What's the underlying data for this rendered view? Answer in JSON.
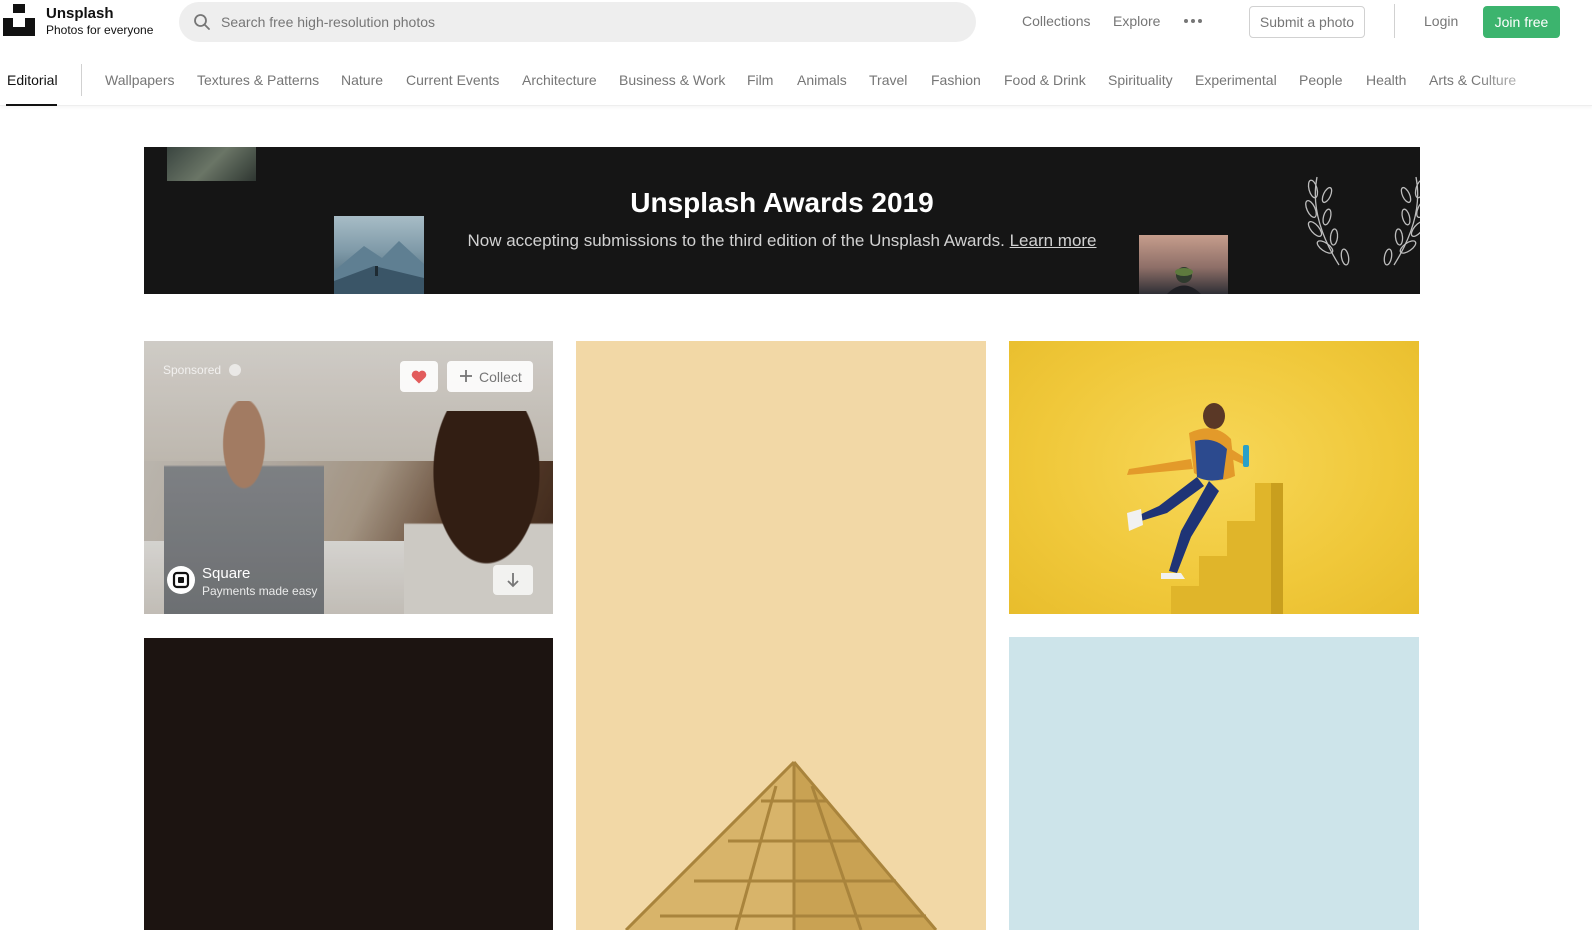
{
  "header": {
    "brand_name": "Unsplash",
    "brand_tagline": "Photos for everyone",
    "search_placeholder": "Search free high-resolution photos",
    "nav": {
      "collections": "Collections",
      "explore": "Explore"
    },
    "submit_label": "Submit a photo",
    "login_label": "Login",
    "join_label": "Join free"
  },
  "categories": {
    "active": "Editorial",
    "items": [
      "Wallpapers",
      "Textures & Patterns",
      "Nature",
      "Current Events",
      "Architecture",
      "Business & Work",
      "Film",
      "Animals",
      "Travel",
      "Fashion",
      "Food & Drink",
      "Spirituality",
      "Experimental",
      "People",
      "Health",
      "Arts & Culture"
    ]
  },
  "banner": {
    "title": "Unsplash Awards 2019",
    "text": "Now accepting submissions to the third edition of the Unsplash Awards.",
    "link": "Learn more"
  },
  "sponsored_card": {
    "label": "Sponsored",
    "collect_label": "Collect",
    "sponsor_name": "Square",
    "sponsor_tagline": "Payments made easy"
  },
  "colors": {
    "accent_green": "#3cb46e",
    "banner_bg": "#151515",
    "photo_tan": "#f2d8a6",
    "photo_yellow": "#f0c83a",
    "photo_dark": "#1c1411",
    "photo_blue": "#cde4ea"
  },
  "icons": {
    "search": "search-icon",
    "more": "more-icon",
    "like": "heart-icon",
    "collect": "plus-icon",
    "download": "arrow-down-icon"
  }
}
